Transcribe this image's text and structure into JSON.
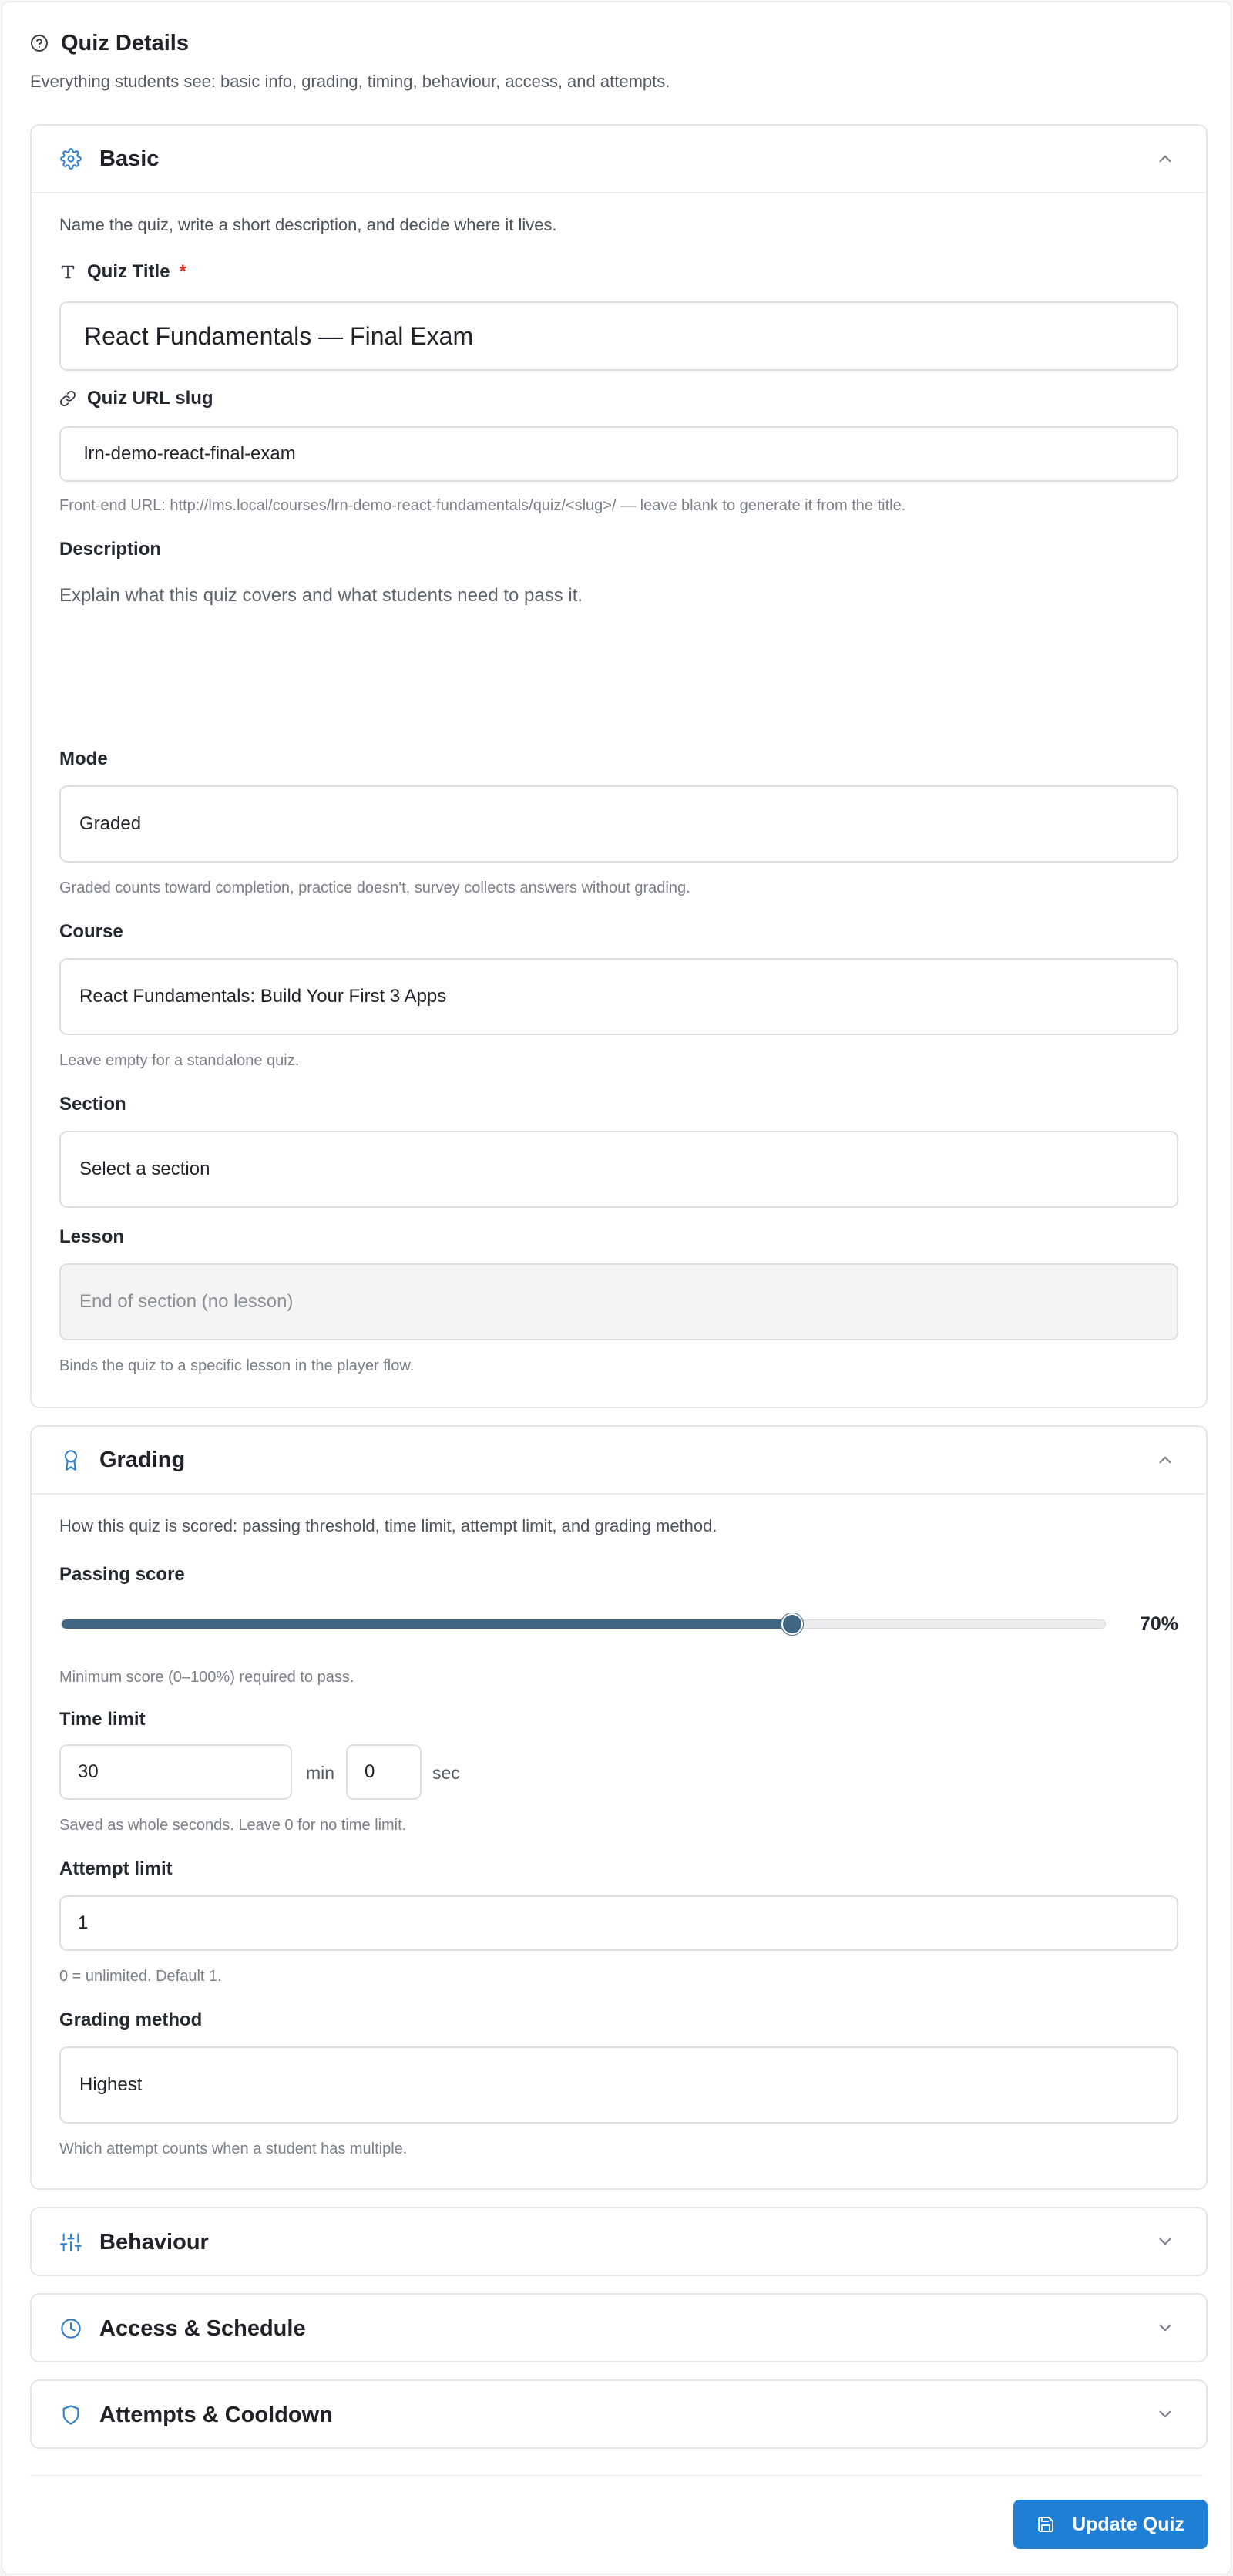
{
  "header": {
    "title": "Quiz Details",
    "subtitle": "Everything students see: basic info, grading, timing, behaviour, access, and attempts."
  },
  "colors": {
    "accent": "#1f7fd4",
    "slider": "#3f6683",
    "required": "#d92d20"
  },
  "basic": {
    "title": "Basic",
    "icon": "gear-icon",
    "intro": "Name the quiz, write a short description, and decide where it lives.",
    "quiz_title_label": "Quiz Title",
    "required_mark": "*",
    "quiz_title_value": "React Fundamentals — Final Exam",
    "slug_label": "Quiz URL slug",
    "slug_value": "lrn-demo-react-final-exam",
    "slug_help": "Front-end URL: http://lms.local/courses/lrn-demo-react-fundamentals/quiz/<slug>/ — leave blank to generate it from the title.",
    "description_label": "Description",
    "description_placeholder": "Explain what this quiz covers and what students need to pass it.",
    "mode_label": "Mode",
    "mode_value": "Graded",
    "mode_help": "Graded counts toward completion, practice doesn't, survey collects answers without grading.",
    "course_label": "Course",
    "course_value": "React Fundamentals: Build Your First 3 Apps",
    "course_help": "Leave empty for a standalone quiz.",
    "section_label": "Section",
    "section_value": "Select a section",
    "lesson_label": "Lesson",
    "lesson_value": "End of section (no lesson)",
    "lesson_help": "Binds the quiz to a specific lesson in the player flow."
  },
  "grading": {
    "title": "Grading",
    "icon": "award-icon",
    "intro": "How this quiz is scored: passing threshold, time limit, attempt limit, and grading method.",
    "passing_label": "Passing score",
    "passing_value": 70,
    "passing_display": "70%",
    "passing_help": "Minimum score (0–100%) required to pass.",
    "time_label": "Time limit",
    "time_minutes": "30",
    "time_min_unit": "min",
    "time_seconds": "0",
    "time_sec_unit": "sec",
    "time_help": "Saved as whole seconds. Leave 0 for no time limit.",
    "attempt_label": "Attempt limit",
    "attempt_value": "1",
    "attempt_help": "0 = unlimited. Default 1.",
    "method_label": "Grading method",
    "method_value": "Highest",
    "method_help": "Which attempt counts when a student has multiple."
  },
  "collapsed_sections": [
    {
      "title": "Behaviour",
      "icon": "sliders-icon"
    },
    {
      "title": "Access & Schedule",
      "icon": "clock-icon"
    },
    {
      "title": "Attempts & Cooldown",
      "icon": "shield-icon"
    }
  ],
  "footer": {
    "update_label": "Update Quiz"
  }
}
